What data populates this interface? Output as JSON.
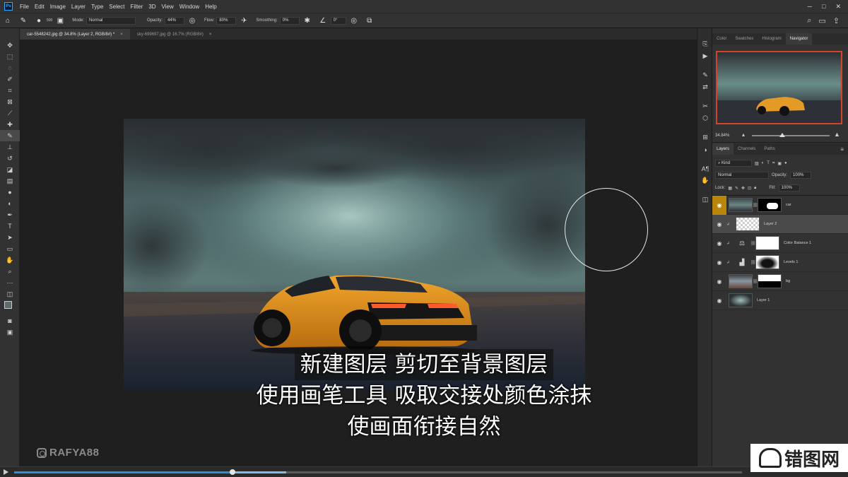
{
  "menubar": {
    "logo": "Ps",
    "items": [
      "File",
      "Edit",
      "Image",
      "Layer",
      "Type",
      "Select",
      "Filter",
      "3D",
      "View",
      "Window",
      "Help"
    ],
    "window_controls": [
      "─",
      "□",
      "✕"
    ]
  },
  "options": {
    "mode_label": "Mode:",
    "mode_value": "Normal",
    "opacity_label": "Opacity:",
    "opacity_value": "44%",
    "flow_label": "Flow:",
    "flow_value": "80%",
    "smoothing_label": "Smoothing:",
    "smoothing_value": "0%",
    "angle_value": "0°",
    "brush_size": "500"
  },
  "tabs": [
    {
      "label": "car-5548242.jpg @ 34.8% (Layer 2, RGB/8#) *",
      "close": "×"
    },
    {
      "label": "sky-699697.jpg @ 16.7% (RGB/8#)",
      "close": "×"
    }
  ],
  "subtitle": {
    "line1": "新建图层 剪切至背景图层",
    "line2": "使用画笔工具 吸取交接处颜色涂抹",
    "line3": "使画面衔接自然"
  },
  "watermark": "RAFYA88",
  "panels": {
    "top_tabs": [
      "Color",
      "Swatches",
      "Histogram",
      "Navigator"
    ],
    "zoom": "34.84%",
    "layer_tabs": [
      "Layers",
      "Channels",
      "Paths"
    ],
    "kind_label": "Kind",
    "blend_mode": "Normal",
    "opacity_label": "Opacity:",
    "opacity_value": "100%",
    "lock_label": "Lock:",
    "fill_label": "Fill:",
    "fill_value": "100%",
    "layers": [
      {
        "name": "car"
      },
      {
        "name": "Layer 2"
      },
      {
        "name": "Color Balance 1"
      },
      {
        "name": "Levels 1"
      },
      {
        "name": "bg"
      },
      {
        "name": "Layer 1"
      }
    ]
  },
  "player": {
    "time": "",
    "progress_fraction": 0.3
  },
  "site_logo": "错图网"
}
